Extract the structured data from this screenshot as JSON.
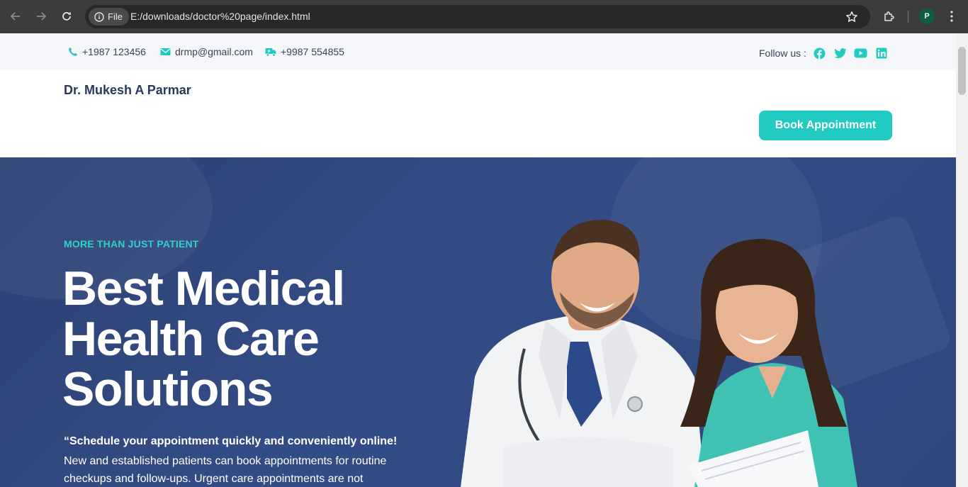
{
  "browser": {
    "site_chip": "File",
    "url": "E:/downloads/doctor%20page/index.html",
    "profile_initial": "P"
  },
  "topbar": {
    "phone": "+1987 123456",
    "email": "drmp@gmail.com",
    "ambulance": "+9987 554855",
    "follow_label": "Follow us :",
    "social_icons": [
      "facebook-icon",
      "twitter-icon",
      "youtube-icon",
      "linkedin-icon"
    ]
  },
  "header": {
    "brand": "Dr. Mukesh A Parmar",
    "book_button": "Book Appointment"
  },
  "hero": {
    "tagline": "MORE THAN JUST PATIENT",
    "headline_1": "Best Medical",
    "headline_2": "Health Care",
    "headline_3": "Solutions",
    "lead_strong": "“Schedule your appointment quickly and conveniently online!",
    "lead": "New and established patients can book appointments for routine checkups and follow-ups. Urgent care appointments are not"
  },
  "colors": {
    "accent": "#22cbc1",
    "hero_bg": "#344c86",
    "chrome": "#3c3c3c"
  }
}
